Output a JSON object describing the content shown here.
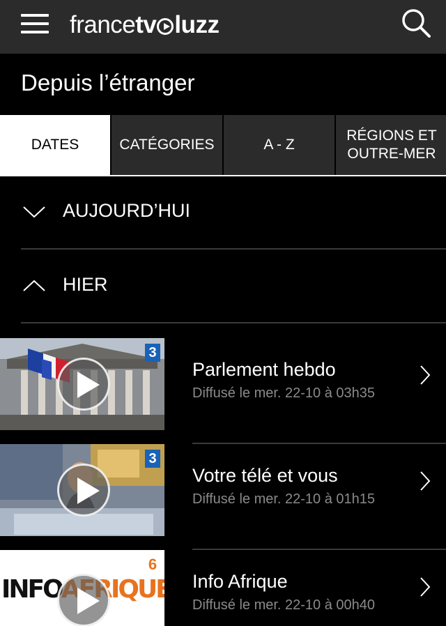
{
  "header": {
    "logo_part1": "france",
    "logo_part2": "tv",
    "logo_part3": "luzz",
    "menu_icon": "hamburger-menu-icon",
    "search_icon": "search-icon"
  },
  "section": {
    "title": "Depuis l’étranger"
  },
  "tabs": [
    {
      "label": "DATES",
      "active": true
    },
    {
      "label": "CATÉGORIES",
      "active": false
    },
    {
      "label": "A - Z",
      "active": false
    },
    {
      "label": "RÉGIONS ET OUTRE-MER",
      "active": false
    }
  ],
  "accordion": [
    {
      "label": "AUJOURD’HUI",
      "expanded": false,
      "icon": "chevron-down-icon"
    },
    {
      "label": "HIER",
      "expanded": true,
      "icon": "chevron-up-icon"
    }
  ],
  "programs": [
    {
      "title": "Parlement hebdo",
      "subtitle": "Diffusé le mer. 22-10 à 03h35",
      "channel": "3"
    },
    {
      "title": "Votre télé et vous",
      "subtitle": "Diffusé le mer. 22-10 à 01h15",
      "channel": "3"
    },
    {
      "title": "Info Afrique",
      "subtitle": "Diffusé le mer. 22-10 à 00h40",
      "channel": "6",
      "thumb_text": "INFO AFRIQUE"
    }
  ],
  "colors": {
    "topbar": "#2b2b2b",
    "background": "#000000",
    "tab_active": "#ffffff",
    "subtitle": "#8a8a8a",
    "channel_blue": "#1a62b8",
    "info_afrique_orange": "#e8731e"
  }
}
